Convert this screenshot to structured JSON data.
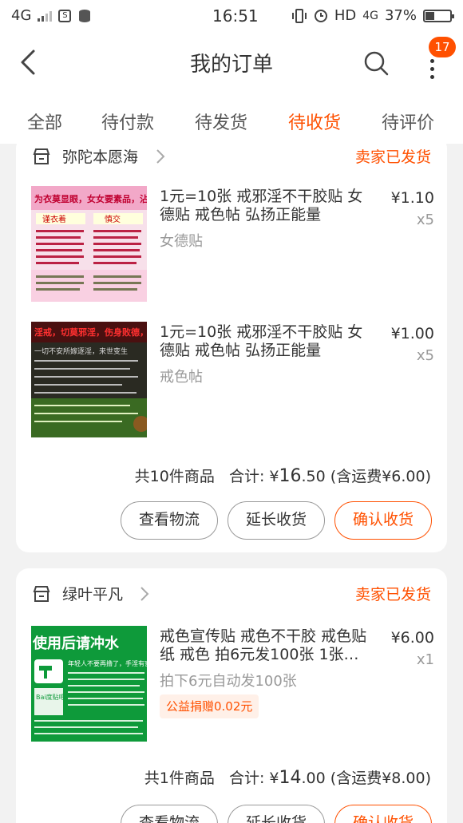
{
  "status_bar": {
    "network_left": "4G",
    "time": "16:51",
    "hd": "HD",
    "network_right": "4G",
    "battery_percent": "37%",
    "battery_level": 0.37
  },
  "header": {
    "title": "我的订单",
    "badge_count": "17"
  },
  "tabs": [
    "全部",
    "待付款",
    "待发货",
    "待收货",
    "待评价"
  ],
  "active_tab": "待收货",
  "colors": {
    "accent": "#ff5000",
    "muted": "#999999"
  },
  "orders": [
    {
      "shop": "弥陀本愿海",
      "status": "卖家已发货",
      "items": [
        {
          "title": "1元=10张 戒邪淫不干胶贴 女德贴 戒色帖 弘扬正能量",
          "sku": "女德贴",
          "price": "¥1.10",
          "qty": "x5"
        },
        {
          "title": "1元=10张 戒邪淫不干胶贴 女德贴 戒色帖 弘扬正能量",
          "sku": "戒色帖",
          "price": "¥1.00",
          "qty": "x5"
        }
      ],
      "summary": {
        "count": "共10件商品",
        "total_label": "合计:",
        "currency": "¥",
        "total_int": "16",
        "total_dec": ".50",
        "shipping": "(含运费¥6.00)"
      },
      "buttons": [
        "查看物流",
        "延长收货",
        "确认收货"
      ]
    },
    {
      "shop": "绿叶平凡",
      "status": "卖家已发货",
      "items": [
        {
          "title": "戒色宣传贴 戒色不干胶 戒色贴纸 戒色 拍6元发100张 1张…",
          "sku": "拍下6元自动发100张",
          "price": "¥6.00",
          "qty": "x1",
          "tag": "公益捐赠0.02元"
        }
      ],
      "summary": {
        "count": "共1件商品",
        "total_label": "合计:",
        "currency": "¥",
        "total_int": "14",
        "total_dec": ".00",
        "shipping": "(含运费¥8.00)"
      },
      "buttons": [
        "查看物流",
        "延长收货",
        "确认收货"
      ]
    }
  ],
  "thumbnails": {
    "img1": {
      "headline": "为衣莫显眼，女女要素品，沾身更自爱，辛福文平",
      "label_left": "谨衣着",
      "label_right": "慎交"
    },
    "img2": {
      "headline": "淫戒，切莫邪淫，伤身败德，",
      "caption": "一切不安所嫁逐淫，来世变生"
    },
    "img3": {
      "headline": "使用后请冲水",
      "logo": "Bai度贴吧 戒色吧",
      "caption": "年轻人不要再撸了，手淫有害"
    }
  },
  "icons": {
    "back": "chevron-left-icon",
    "search": "search-icon",
    "more": "more-vertical-icon",
    "shop": "shop-icon",
    "chevron": "chevron-right-icon"
  }
}
